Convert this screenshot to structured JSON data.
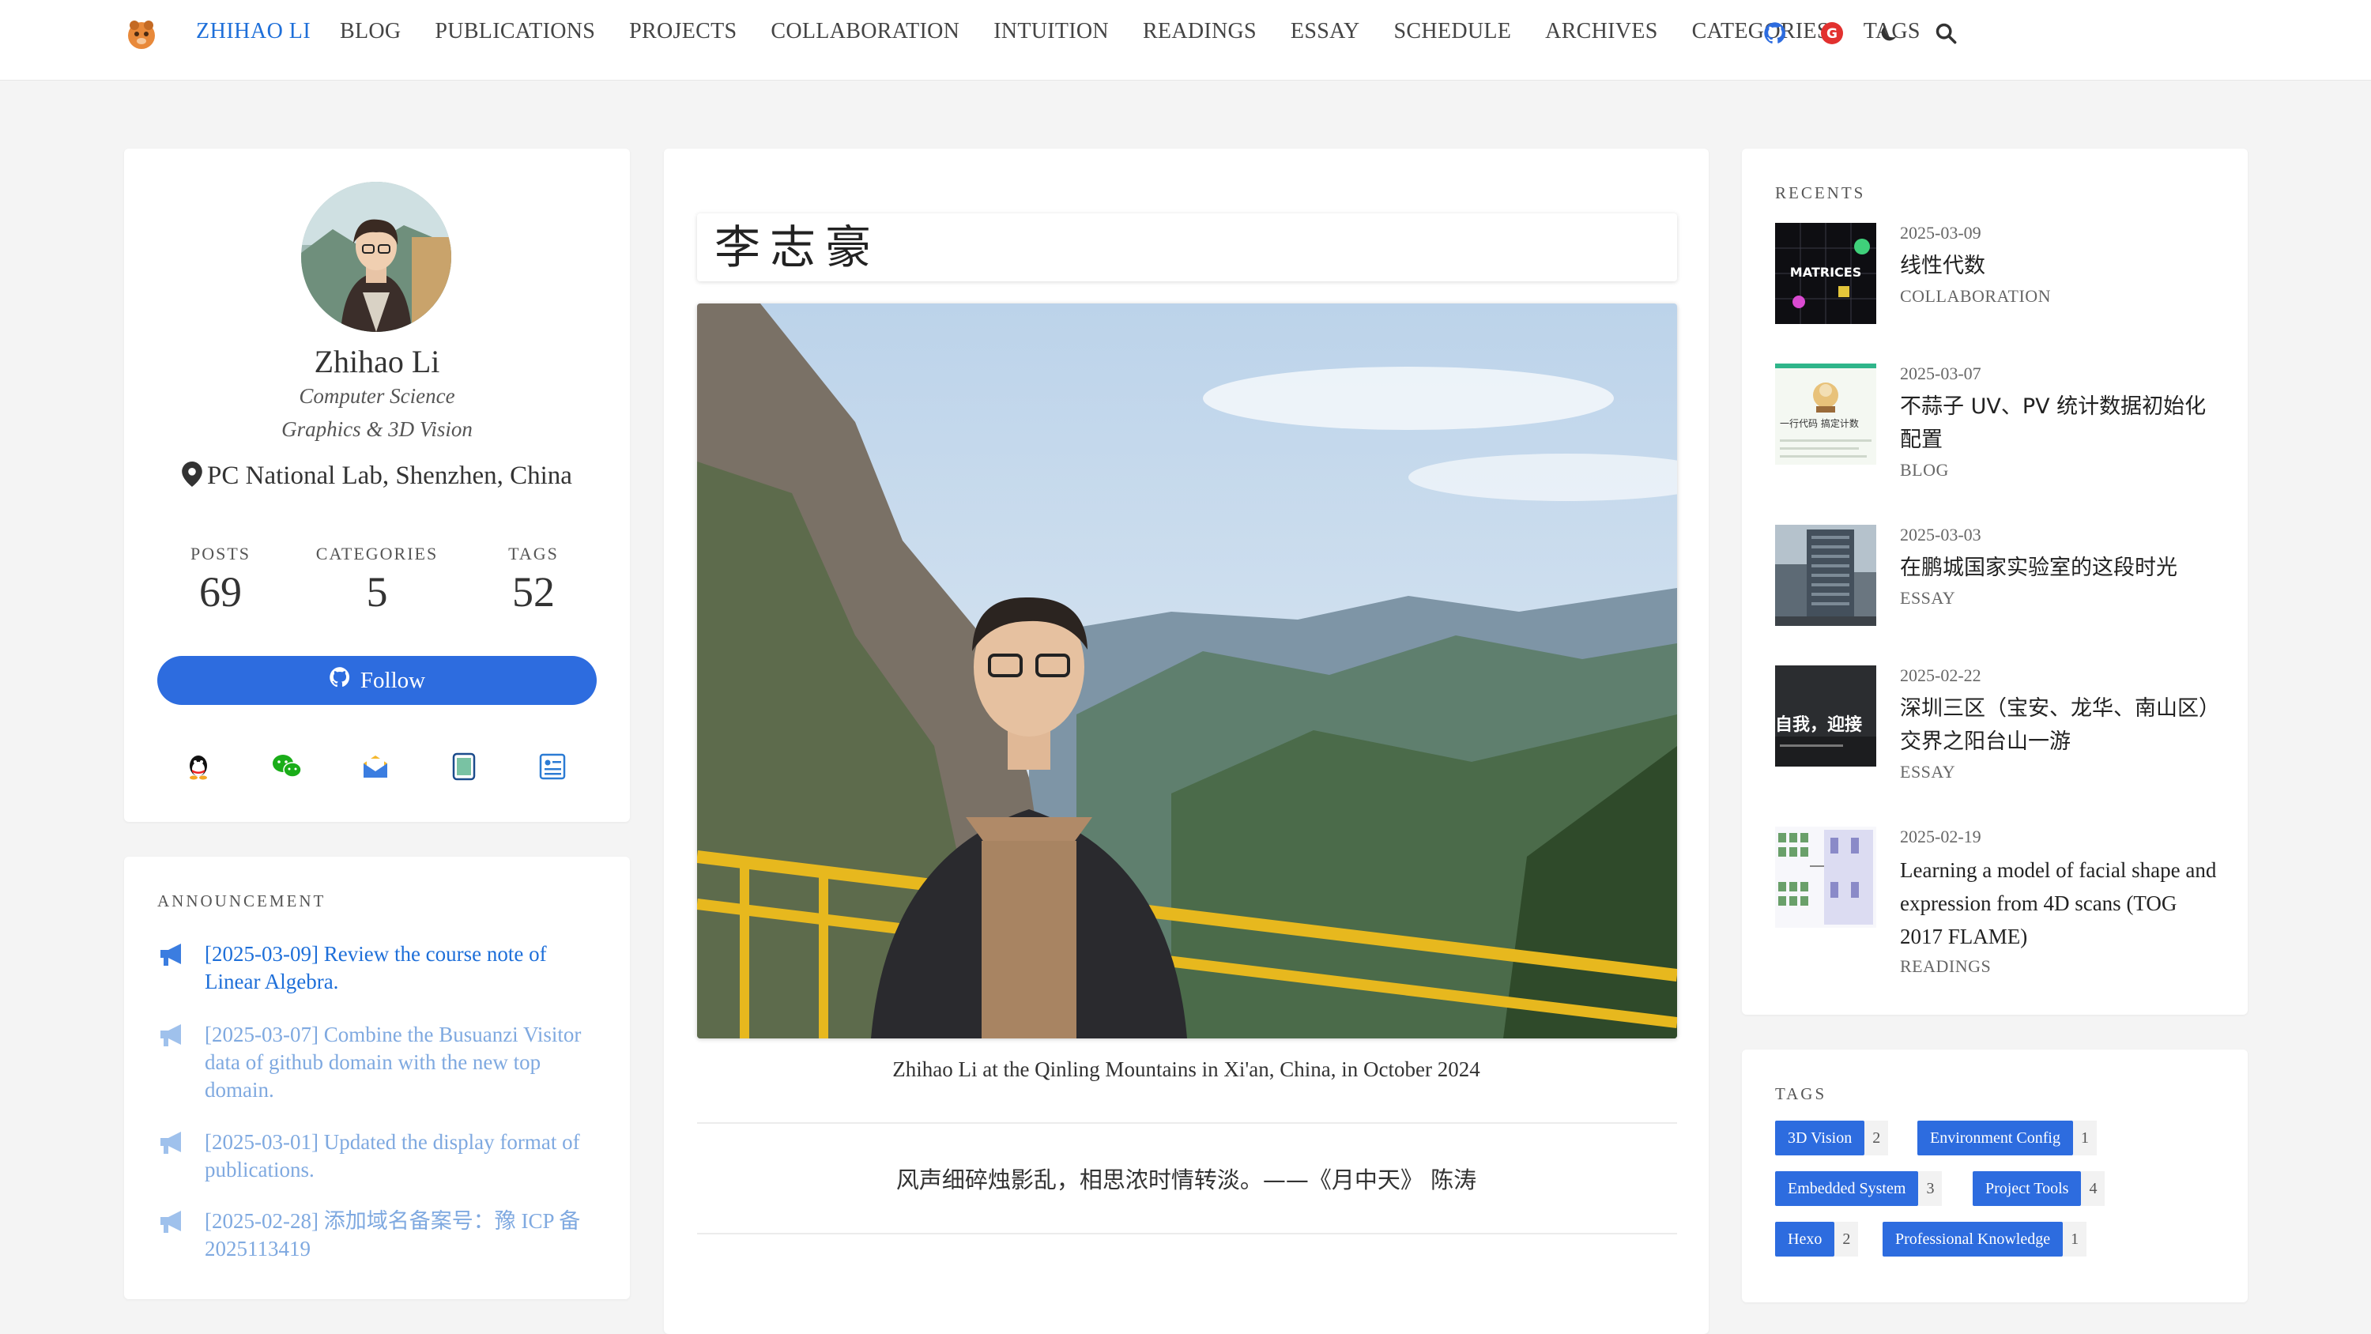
{
  "brand": "ZHIHAO LI",
  "nav": [
    "BLOG",
    "PUBLICATIONS",
    "PROJECTS",
    "COLLABORATION",
    "INTUITION",
    "READINGS",
    "ESSAY",
    "SCHEDULE",
    "ARCHIVES",
    "CATEGORIES",
    "TAGS"
  ],
  "top_icons": [
    "github-icon",
    "g-icon",
    "moon-icon",
    "search-icon"
  ],
  "profile": {
    "name": "Zhihao Li",
    "title1": "Computer Science",
    "title2": "Graphics & 3D Vision",
    "location": "PC National Lab, Shenzhen, China",
    "stats": [
      {
        "label": "POSTS",
        "value": "69"
      },
      {
        "label": "CATEGORIES",
        "value": "5"
      },
      {
        "label": "TAGS",
        "value": "52"
      }
    ],
    "follow_label": "Follow",
    "socials": [
      "qq-icon",
      "wechat-icon",
      "mail-icon",
      "note-icon",
      "resume-icon"
    ]
  },
  "announcement": {
    "title": "ANNOUNCEMENT",
    "items": [
      "[2025-03-09] Review the course note of Linear Algebra.",
      "[2025-03-07] Combine the Busuanzi Visitor data of github domain with the new top domain.",
      "[2025-03-01] Updated the display format of publications.",
      "[2025-02-28] 添加域名备案号：豫 ICP 备 2025113419"
    ]
  },
  "center": {
    "name_cn": "李志豪",
    "caption": "Zhihao Li at the Qinling Mountains in Xi'an, China, in October 2024",
    "quote": "风声细碎烛影乱，相思浓时情转淡。——《月中天》 陈涛"
  },
  "recents": {
    "title": "RECENTS",
    "items": [
      {
        "date": "2025-03-09",
        "title": "线性代数",
        "category": "COLLABORATION",
        "thumb_text": "MATRICES"
      },
      {
        "date": "2025-03-07",
        "title": "不蒜子 UV、PV 统计数据初始化配置",
        "category": "BLOG",
        "thumb_text": "一行代码 搞定计数"
      },
      {
        "date": "2025-03-03",
        "title": "在鹏城国家实验室的这段时光",
        "category": "ESSAY",
        "thumb_text": ""
      },
      {
        "date": "2025-02-22",
        "title": "深圳三区（宝安、龙华、南山区）交界之阳台山一游",
        "category": "ESSAY",
        "thumb_text": "自我，迎接"
      },
      {
        "date": "2025-02-19",
        "title": "Learning a model of facial shape and expression from 4D scans (TOG 2017 FLAME)",
        "category": "READINGS",
        "thumb_text": ""
      }
    ]
  },
  "tags": {
    "title": "TAGS",
    "items": [
      {
        "name": "3D Vision",
        "count": "2"
      },
      {
        "name": "Environment Config",
        "count": "1"
      },
      {
        "name": "Embedded System",
        "count": "3"
      },
      {
        "name": "Project Tools",
        "count": "4"
      },
      {
        "name": "Hexo",
        "count": "2"
      },
      {
        "name": "Professional Knowledge",
        "count": "1"
      }
    ]
  },
  "colors": {
    "accent": "#2d6cdf",
    "link": "#1e6fd9",
    "link_faded": "#7fa9e0",
    "background": "#f4f4f4"
  }
}
